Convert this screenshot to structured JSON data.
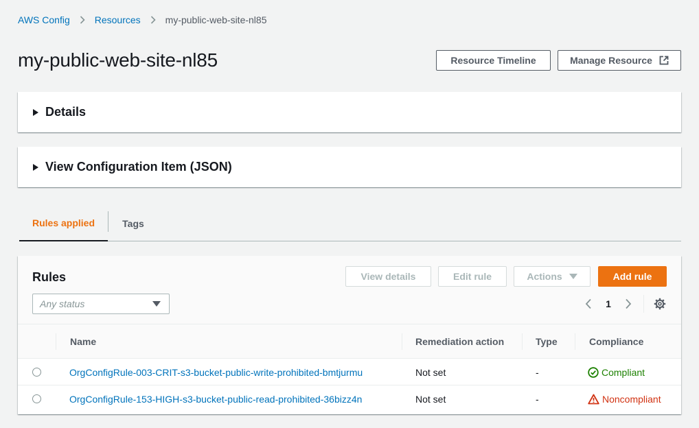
{
  "breadcrumb": {
    "items": [
      "AWS Config",
      "Resources",
      "my-public-web-site-nl85"
    ]
  },
  "page": {
    "title": "my-public-web-site-nl85",
    "timeline_button": "Resource Timeline",
    "manage_button": "Manage Resource"
  },
  "sections": {
    "details": "Details",
    "json": "View Configuration Item (JSON)"
  },
  "tabs": [
    {
      "label": "Rules applied",
      "active": true
    },
    {
      "label": "Tags",
      "active": false
    }
  ],
  "rules_panel": {
    "title": "Rules",
    "view_details": "View details",
    "edit_rule": "Edit rule",
    "actions": "Actions",
    "add_rule": "Add rule",
    "status_placeholder": "Any status",
    "page": "1"
  },
  "table": {
    "columns": [
      "Name",
      "Remediation action",
      "Type",
      "Compliance"
    ],
    "rows": [
      {
        "name": "OrgConfigRule-003-CRIT-s3-bucket-public-write-prohibited-bmtjurmu",
        "remediation": "Not set",
        "type": "-",
        "compliance": "Compliant",
        "compliance_icon": "check-circle-icon"
      },
      {
        "name": "OrgConfigRule-153-HIGH-s3-bucket-public-read-prohibited-36bizz4n",
        "remediation": "Not set",
        "type": "-",
        "compliance": "Noncompliant",
        "compliance_icon": "warning-triangle-icon"
      }
    ]
  },
  "colors": {
    "link": "#0073bb",
    "accent": "#ec7211",
    "success": "#1d8102",
    "error": "#d13212"
  }
}
